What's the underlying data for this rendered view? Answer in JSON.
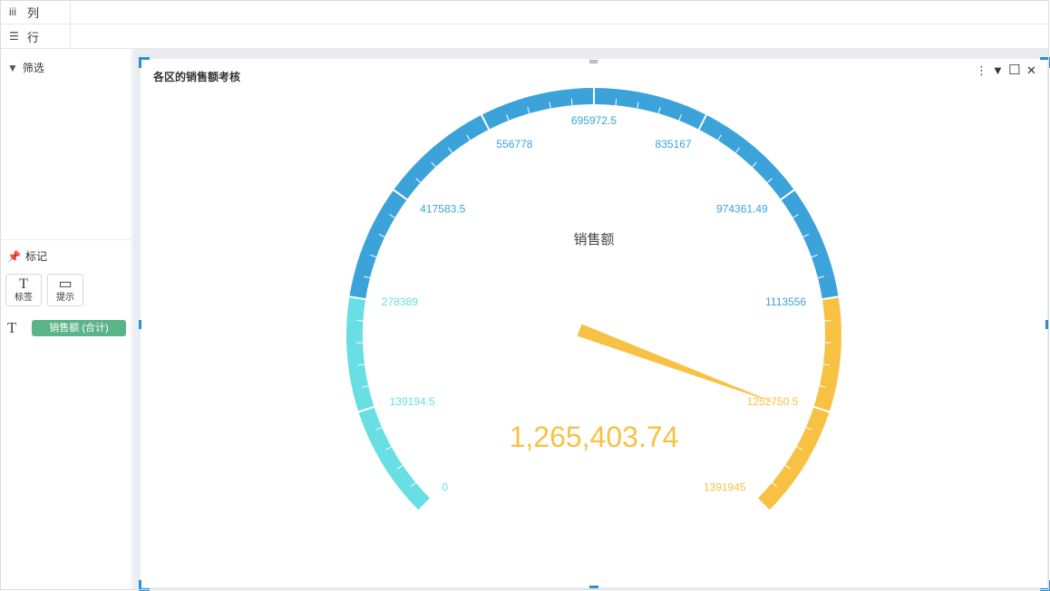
{
  "shelf": {
    "columns_label": "列",
    "rows_label": "行"
  },
  "sidebar": {
    "filter_label": "筛选",
    "marks_label": "标记",
    "mark_buttons": [
      {
        "glyph": "T",
        "label": "标签"
      },
      {
        "glyph": "▭",
        "label": "提示"
      }
    ],
    "mark_field_glyph": "T",
    "mark_field": "销售额 (合计)"
  },
  "card": {
    "title": "各区的销售额考核"
  },
  "colors": {
    "accent": "#2a8fd4",
    "low": "#67dfe3",
    "mid": "#3ba3da",
    "high": "#f7c243",
    "pill": "#5bb389"
  },
  "chart_data": {
    "type": "gauge",
    "title": "各区的销售额考核",
    "series_name": "销售额",
    "min": 0,
    "max": 1391945,
    "value": 1265403.74,
    "value_label": "1,265,403.74",
    "start_angle_deg": 225,
    "end_angle_deg": -45,
    "bands": [
      {
        "from": 0,
        "to": 278389,
        "color": "#67dfe3"
      },
      {
        "from": 278389,
        "to": 1113556,
        "color": "#3ba3da"
      },
      {
        "from": 1113556,
        "to": 1391945,
        "color": "#f7c243"
      }
    ],
    "tick_labels": [
      {
        "value": 0,
        "text": "0"
      },
      {
        "value": 139194.5,
        "text": "139194.5"
      },
      {
        "value": 278389,
        "text": "278389"
      },
      {
        "value": 417583.5,
        "text": "417583.5"
      },
      {
        "value": 556778,
        "text": "556778"
      },
      {
        "value": 695972.5,
        "text": "695972.5"
      },
      {
        "value": 835167,
        "text": "835167"
      },
      {
        "value": 974361.49,
        "text": "974361.49"
      },
      {
        "value": 1113556,
        "text": "1113556"
      },
      {
        "value": 1252750.5,
        "text": "1252750.5"
      },
      {
        "value": 1391945,
        "text": "1391945"
      }
    ]
  }
}
